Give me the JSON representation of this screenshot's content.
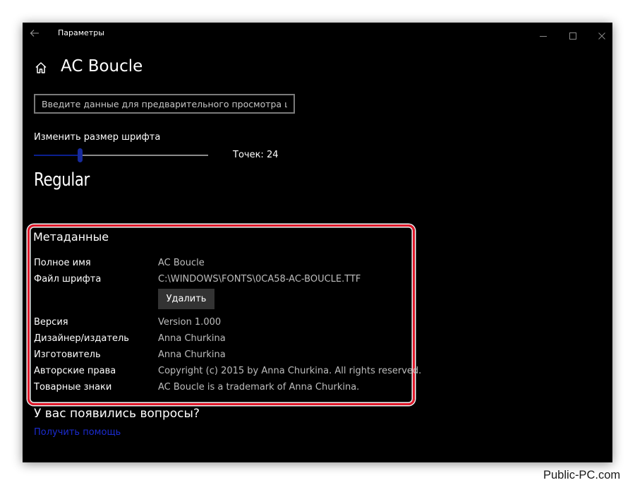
{
  "window": {
    "title": "Параметры"
  },
  "page": {
    "title": "AC Boucle"
  },
  "preview": {
    "placeholder": "Введите данные для предварительного просмотра шрифта"
  },
  "font_size": {
    "label": "Изменить размер шрифта",
    "readout": "Точек: 24",
    "level_fraction": 0.26
  },
  "style": {
    "name": "Regular"
  },
  "metadata": {
    "title": "Метаданные",
    "full_name_label": "Полное имя",
    "full_name_value": "AC Boucle",
    "file_label": "Файл шрифта",
    "file_value": "C:\\WINDOWS\\FONTS\\0CA58-AC-BOUCLE.TTF",
    "delete_label": "Удалить",
    "version_label": "Версия",
    "version_value": "Version 1.000",
    "designer_label": "Дизайнер/издатель",
    "designer_value": "Anna Churkina",
    "manufacturer_label": "Изготовитель",
    "manufacturer_value": "Anna Churkina",
    "copyright_label": "Авторские права",
    "copyright_value": "Copyright (c) 2015 by Anna Churkina. All rights reserved.",
    "trademark_label": "Товарные знаки",
    "trademark_value": "AC Boucle is a trademark of Anna Churkina."
  },
  "help": {
    "title": "У вас появились вопросы?",
    "link": "Получить помощь"
  },
  "watermark": {
    "text": "Public-PC.com"
  },
  "colors": {
    "accent": "#172a9c",
    "link": "#1b2bd0",
    "highlight_border": "#e0192b"
  }
}
